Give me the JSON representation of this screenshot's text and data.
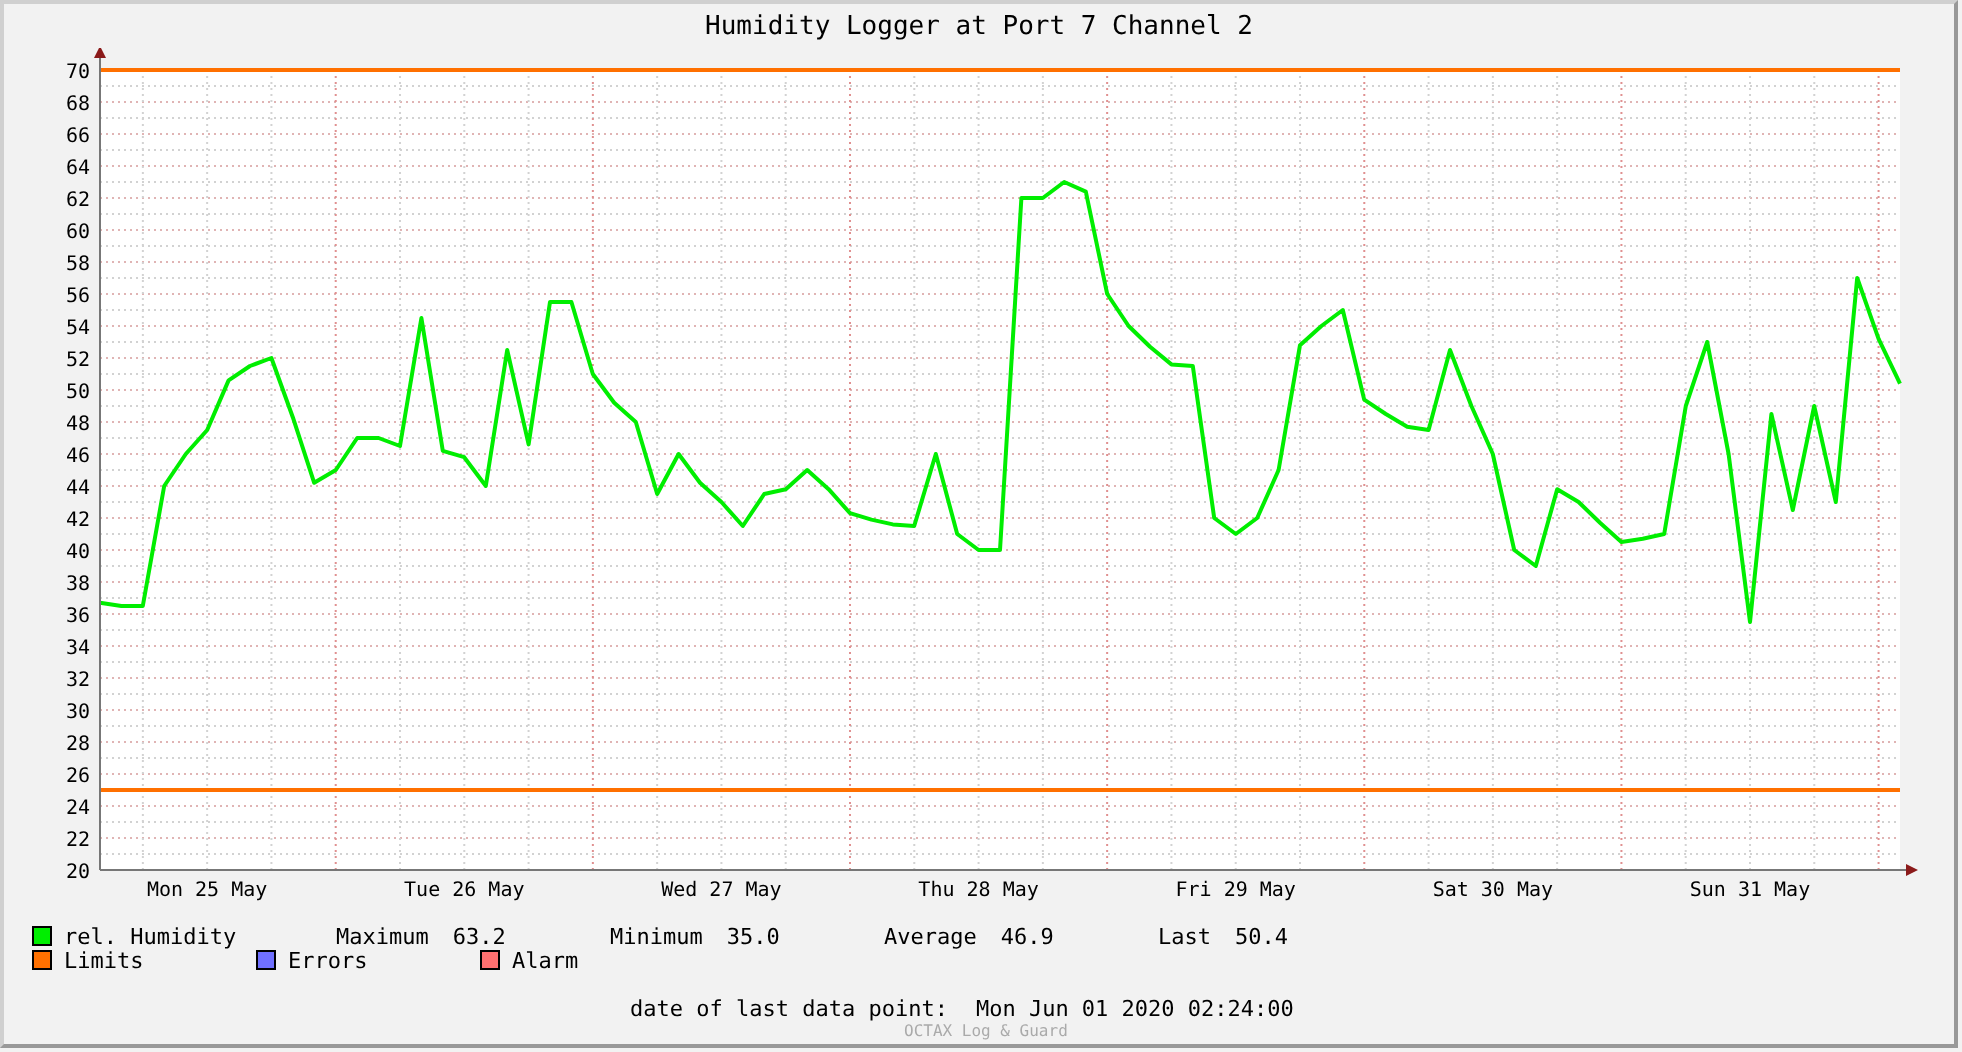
{
  "chart": {
    "chart_data": {
      "type": "line",
      "title": "Humidity Logger at Port 7 Channel 2",
      "categories": [
        null,
        null,
        null,
        null,
        null,
        "Mon 25 May",
        null,
        null,
        null,
        null,
        null,
        null,
        null,
        null,
        null,
        null,
        null,
        "Tue 26 May",
        null,
        null,
        null,
        null,
        null,
        null,
        null,
        null,
        null,
        null,
        null,
        "Wed 27 May",
        null,
        null,
        null,
        null,
        null,
        null,
        null,
        null,
        null,
        null,
        null,
        "Thu 28 May",
        null,
        null,
        null,
        null,
        null,
        null,
        null,
        null,
        null,
        null,
        null,
        "Fri 29 May",
        null,
        null,
        null,
        null,
        null,
        null,
        null,
        null,
        null,
        null,
        null,
        "Sat 30 May",
        null,
        null,
        null,
        null,
        null,
        null,
        null,
        null,
        null,
        null,
        null,
        "Sun 31 May",
        null,
        null,
        null,
        null,
        null,
        null,
        null
      ],
      "series": [
        {
          "name": "rel. Humidity",
          "color": "#00ee00",
          "values": [
            36.7,
            36.5,
            36.5,
            44,
            46,
            47.5,
            50.6,
            51.5,
            52,
            48.3,
            44.2,
            45,
            47,
            47,
            46.5,
            54.5,
            46.2,
            45.8,
            44,
            52.5,
            46.6,
            55.5,
            55.5,
            51,
            49.2,
            48,
            43.5,
            46,
            44.2,
            43,
            41.5,
            43.5,
            43.8,
            45,
            43.8,
            42.3,
            41.9,
            41.6,
            41.5,
            46,
            41,
            40,
            40,
            62,
            62,
            63,
            62.4,
            56,
            54,
            52.7,
            51.6,
            51.5,
            42,
            41,
            42,
            45,
            52.8,
            54,
            55,
            49.4,
            48.5,
            47.7,
            47.5,
            52.5,
            49,
            46,
            40,
            39,
            43.8,
            43,
            41.7,
            40.5,
            40.7,
            41,
            49,
            53,
            46,
            35.5,
            48.5,
            42.5,
            49,
            43,
            57,
            53.2,
            50.4
          ]
        }
      ],
      "ylim": [
        20,
        70
      ],
      "grid": true,
      "yticks": [
        20,
        22,
        24,
        26,
        28,
        30,
        32,
        34,
        36,
        38,
        40,
        42,
        44,
        46,
        48,
        50,
        52,
        54,
        56,
        58,
        60,
        62,
        64,
        66,
        68,
        70
      ],
      "ref_lines": [
        {
          "axis": "y",
          "value": 70
        },
        {
          "axis": "y",
          "value": 25
        }
      ]
    }
  },
  "legend": [
    {
      "label": "Limits",
      "color": "#ff7000"
    },
    {
      "label": "Errors",
      "color": "#7070ff"
    },
    {
      "label": "Alarm",
      "color": "#ff7070"
    }
  ],
  "stats": [
    {
      "label": "Maximum",
      "value": "63.2"
    },
    {
      "label": "Minimum",
      "value": "35.0"
    },
    {
      "label": "Average",
      "value": "46.9"
    },
    {
      "label": "Last",
      "value": "50.4"
    }
  ],
  "last_data_point": {
    "label": "date of last data point:",
    "value": "Mon Jun 01 2020 02:24:00"
  },
  "credit": "OCTAX Log & Guard"
}
